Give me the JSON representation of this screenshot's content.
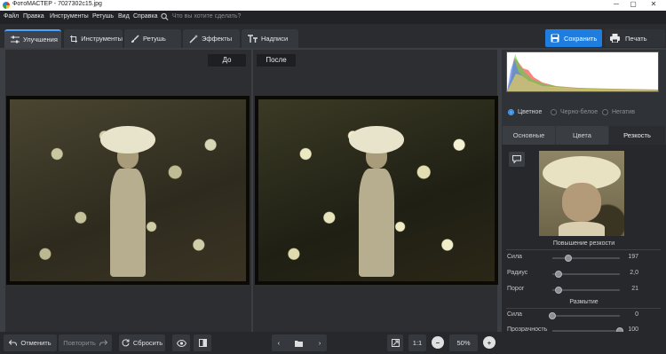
{
  "window": {
    "title": "ФотоМАСТЕР - 7027302c15.jpg",
    "controls": [
      "─",
      "▢",
      "✕"
    ]
  },
  "menu": {
    "items": [
      "Файл",
      "Правка",
      "Инструменты",
      "Ретушь",
      "Вид",
      "Справка"
    ],
    "search_placeholder": "Что вы хотите сделать?"
  },
  "tabs": [
    {
      "label": "Улучшения",
      "icon": "sliders-icon",
      "active": true
    },
    {
      "label": "Инструменты",
      "icon": "crop-icon",
      "active": false
    },
    {
      "label": "Ретушь",
      "icon": "brush-icon",
      "active": false
    },
    {
      "label": "Эффекты",
      "icon": "magic-wand-icon",
      "active": false
    },
    {
      "label": "Надписи",
      "icon": "text-icon",
      "active": false
    }
  ],
  "actions": {
    "save": "Сохранить",
    "print": "Печать"
  },
  "viewer": {
    "before_label": "До",
    "after_label": "После"
  },
  "color_modes": [
    {
      "label": "Цветное",
      "selected": true
    },
    {
      "label": "Черно-белое",
      "selected": false
    },
    {
      "label": "Негатив",
      "selected": false
    }
  ],
  "sub_tabs": [
    {
      "label": "Основные",
      "active": false
    },
    {
      "label": "Цвета",
      "active": false
    },
    {
      "label": "Резкость",
      "active": true
    }
  ],
  "sharpness": {
    "section_title": "Повышение резкости",
    "sliders": [
      {
        "label": "Сила",
        "value": "197",
        "fraction": 0.24
      },
      {
        "label": "Радиус",
        "value": "2,0",
        "fraction": 0.09
      },
      {
        "label": "Порог",
        "value": "21",
        "fraction": 0.09
      }
    ]
  },
  "blur": {
    "section_title": "Размытие",
    "sliders": [
      {
        "label": "Сила",
        "value": "0",
        "fraction": 0.0
      },
      {
        "label": "Прозрачность",
        "value": "100",
        "fraction": 1.0
      }
    ]
  },
  "bottom": {
    "undo": "Отменить",
    "redo": "Повторить",
    "reset": "Сбросить",
    "ratio": "1:1",
    "zoom": "50%"
  },
  "colors": {
    "accent": "#1f7de0",
    "tab_highlight": "#4aa3ff"
  }
}
